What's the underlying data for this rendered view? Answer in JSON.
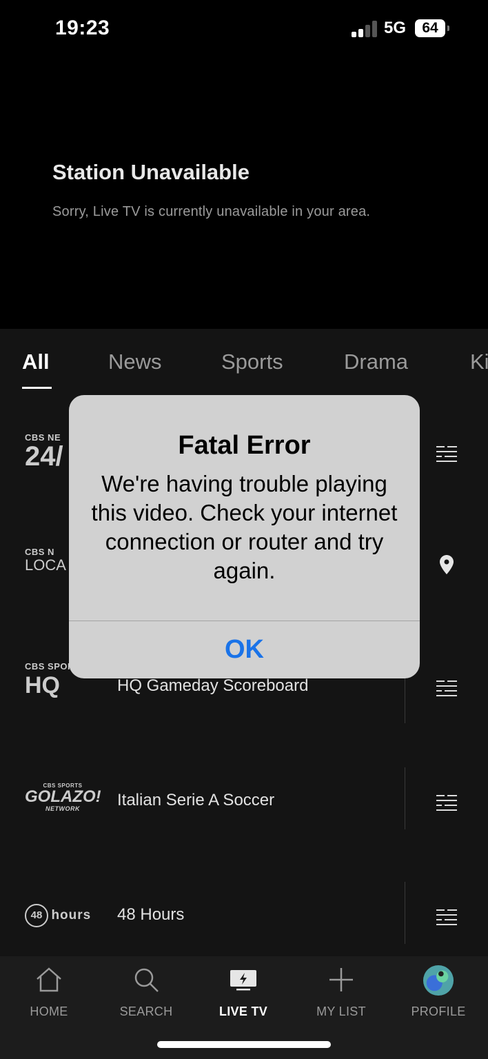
{
  "status_bar": {
    "time": "19:23",
    "network": "5G",
    "battery": "64"
  },
  "player": {
    "title": "Station Unavailable",
    "message": "Sorry, Live TV is currently unavailable in your area."
  },
  "tabs": [
    "All",
    "News",
    "Sports",
    "Drama",
    "Ki"
  ],
  "channels": [
    {
      "logo_small": "CBS NE",
      "logo_big": "24/",
      "title": "",
      "icon": "guide-icon"
    },
    {
      "logo_small": "CBS N",
      "logo_big": "LOCA",
      "title": "",
      "icon": "location-pin-icon"
    },
    {
      "logo_small": "CBS SPOR",
      "logo_big": "HQ",
      "title": "HQ Gameday Scoreboard",
      "icon": "guide-icon"
    },
    {
      "logo_small": "CBS SPORTS",
      "logo_big": "GOLAZO!",
      "logo_sub": "NETWORK",
      "title": "Italian Serie A Soccer",
      "icon": "guide-icon"
    },
    {
      "logo_small": "48",
      "logo_big": "hours",
      "title": "48 Hours",
      "icon": "guide-icon"
    }
  ],
  "nav": [
    {
      "label": "HOME",
      "icon": "home-icon"
    },
    {
      "label": "SEARCH",
      "icon": "search-icon"
    },
    {
      "label": "LIVE TV",
      "icon": "live-tv-icon",
      "active": true
    },
    {
      "label": "MY LIST",
      "icon": "plus-icon"
    },
    {
      "label": "PROFILE",
      "icon": "avatar"
    }
  ],
  "dialog": {
    "title": "Fatal Error",
    "message": "We're having trouble playing this video. Check your internet connection or router and try again.",
    "ok": "OK"
  },
  "colors": {
    "accent": "#1a73e8",
    "background": "#141414",
    "dialog": "#d1d1d1"
  }
}
